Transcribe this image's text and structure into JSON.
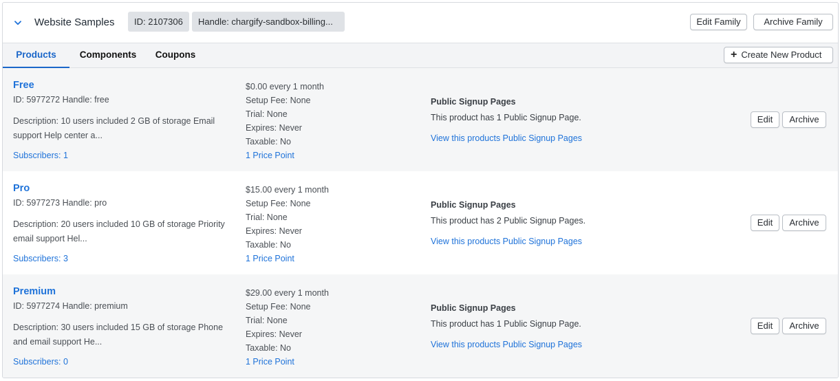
{
  "family": {
    "title": "Website Samples",
    "id_label": "ID: 2107306",
    "handle_label": "Handle: chargify-sandbox-billing...",
    "edit_label": "Edit Family",
    "archive_label": "Archive Family"
  },
  "tabs": {
    "products": "Products",
    "components": "Components",
    "coupons": "Coupons",
    "create_label": "Create New Product"
  },
  "products": [
    {
      "name": "Free",
      "meta": "ID: 5977272 Handle: free",
      "description": "Description: 10 users included 2 GB of storage Email support Help center a...",
      "subscribers": "Subscribers: 1",
      "price": "$0.00 every 1 month",
      "setup_fee": "Setup Fee: None",
      "trial": "Trial: None",
      "expires": "Expires: Never",
      "taxable": "Taxable: No",
      "price_points": "1 Price Point",
      "signup_title": "Public Signup Pages",
      "signup_count": "This product has 1 Public Signup Page.",
      "signup_link": "View this products Public Signup Pages",
      "edit_label": "Edit",
      "archive_label": "Archive"
    },
    {
      "name": "Pro",
      "meta": "ID: 5977273 Handle: pro",
      "description": "Description: 20 users included 10 GB of storage Priority email support Hel...",
      "subscribers": "Subscribers: 3",
      "price": "$15.00 every 1 month",
      "setup_fee": "Setup Fee: None",
      "trial": "Trial: None",
      "expires": "Expires: Never",
      "taxable": "Taxable: No",
      "price_points": "1 Price Point",
      "signup_title": "Public Signup Pages",
      "signup_count": "This product has 2 Public Signup Pages.",
      "signup_link": "View this products Public Signup Pages",
      "edit_label": "Edit",
      "archive_label": "Archive"
    },
    {
      "name": "Premium",
      "meta": "ID: 5977274 Handle: premium",
      "description": "Description: 30 users included 15 GB of storage Phone and email support He...",
      "subscribers": "Subscribers: 0",
      "price": "$29.00 every 1 month",
      "setup_fee": "Setup Fee: None",
      "trial": "Trial: None",
      "expires": "Expires: Never",
      "taxable": "Taxable: No",
      "price_points": "1 Price Point",
      "signup_title": "Public Signup Pages",
      "signup_count": "This product has 1 Public Signup Page.",
      "signup_link": "View this products Public Signup Pages",
      "edit_label": "Edit",
      "archive_label": "Archive"
    }
  ],
  "icons": {
    "collapse": "chevron-down-icon",
    "create": "plus-icon"
  },
  "colors": {
    "accent": "#1e72d9",
    "row_bg": "#f5f6f7",
    "tab_bar_bg": "#f3f4f6",
    "pill_bg": "#dfe2e6"
  }
}
